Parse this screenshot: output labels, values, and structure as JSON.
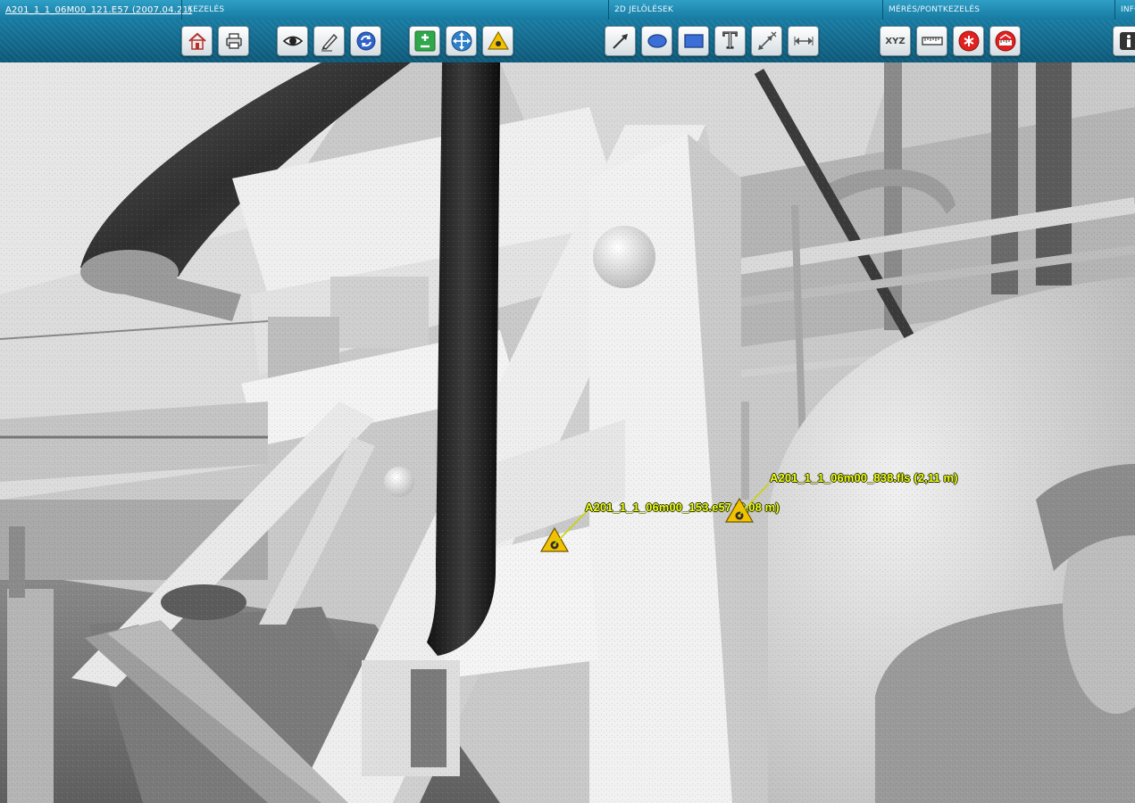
{
  "header": {
    "file_title": "A201_1_1_06M00_121.E57 (2007.04.21)",
    "sections": {
      "kezeles": "KEZELÉS",
      "jelolesek": "2D JELÖLÉSEK",
      "meres": "MÉRÉS/PONTKEZELÉS",
      "info": "INFO"
    }
  },
  "toolbar": {
    "xyz_label": "XYZ",
    "text_label": "T",
    "buttons": [
      {
        "name": "home-icon"
      },
      {
        "name": "print-icon"
      },
      {
        "name": "eye-icon"
      },
      {
        "name": "pencil-icon"
      },
      {
        "name": "refresh-icon"
      },
      {
        "name": "zoom-plus-minus-icon"
      },
      {
        "name": "move-icon"
      },
      {
        "name": "warning-marker-icon"
      },
      {
        "name": "arrow-draw-icon"
      },
      {
        "name": "ellipse-icon"
      },
      {
        "name": "rectangle-icon"
      },
      {
        "name": "text-icon"
      },
      {
        "name": "dimension-icon"
      },
      {
        "name": "width-arrows-icon"
      },
      {
        "name": "xyz-icon"
      },
      {
        "name": "ruler-icon"
      },
      {
        "name": "delete-point-icon"
      },
      {
        "name": "measure-area-icon"
      },
      {
        "name": "info-icon"
      }
    ]
  },
  "markers": [
    {
      "label": "A201_1_1_06m00_153.e57 (3,08 m)"
    },
    {
      "label": "A201_1_1_06m00_838.fls (2,11 m)"
    }
  ],
  "colors": {
    "header_blue": "#177aa1",
    "marker_yellow": "#f4ff1a",
    "marker_fill": "#f2c200"
  }
}
